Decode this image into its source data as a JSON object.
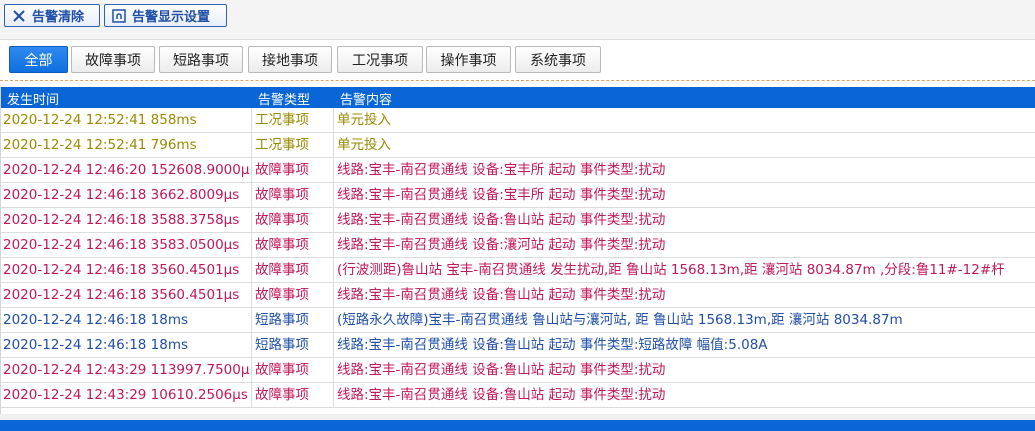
{
  "toolbar": {
    "clear_label": "告警清除",
    "settings_label": "告警显示设置"
  },
  "tabs": [
    {
      "label": "全部",
      "active": true
    },
    {
      "label": "故障事项"
    },
    {
      "label": "短路事项"
    },
    {
      "label": "接地事项"
    },
    {
      "label": "工况事项"
    },
    {
      "label": "操作事项"
    },
    {
      "label": "系统事项"
    }
  ],
  "table": {
    "headers": [
      "发生时间",
      "告警类型",
      "告警内容"
    ],
    "rows": [
      {
        "time": "2020-12-24 12:52:41 858ms",
        "type": "工况事项",
        "content": "单元投入",
        "color": "#9a8a00"
      },
      {
        "time": "2020-12-24 12:52:41 796ms",
        "type": "工况事项",
        "content": "单元投入",
        "color": "#9a8a00"
      },
      {
        "time": "2020-12-24 12:46:20 152608.9000μs",
        "type": "故障事项",
        "content": "线路:宝丰-南召贯通线 设备:宝丰所 起动  事件类型:扰动",
        "color": "#c0185a"
      },
      {
        "time": "2020-12-24 12:46:18 3662.8009μs",
        "type": "故障事项",
        "content": "线路:宝丰-南召贯通线 设备:宝丰所 起动  事件类型:扰动",
        "color": "#c0185a"
      },
      {
        "time": "2020-12-24 12:46:18 3588.3758μs",
        "type": "故障事项",
        "content": "线路:宝丰-南召贯通线 设备:鲁山站 起动  事件类型:扰动",
        "color": "#c0185a"
      },
      {
        "time": "2020-12-24 12:46:18 3583.0500μs",
        "type": "故障事项",
        "content": "线路:宝丰-南召贯通线 设备:瀼河站 起动  事件类型:扰动",
        "color": "#c0185a"
      },
      {
        "time": "2020-12-24 12:46:18 3560.4501μs",
        "type": "故障事项",
        "content": "(行波测距)鲁山站 宝丰-南召贯通线  发生扰动,距 鲁山站 1568.13m,距 瀼河站 8034.87m ,分段:鲁11#-12#杆",
        "color": "#c0185a"
      },
      {
        "time": "2020-12-24 12:46:18 3560.4501μs",
        "type": "故障事项",
        "content": "线路:宝丰-南召贯通线 设备:鲁山站 起动  事件类型:扰动",
        "color": "#c0185a"
      },
      {
        "time": "2020-12-24 12:46:18 18ms",
        "type": "短路事项",
        "content": "(短路永久故障)宝丰-南召贯通线 鲁山站与瀼河站, 距 鲁山站 1568.13m,距 瀼河站 8034.87m",
        "color": "#1f4fa8"
      },
      {
        "time": "2020-12-24 12:46:18 18ms",
        "type": "短路事项",
        "content": "线路:宝丰-南召贯通线 设备:鲁山站 起动  事件类型:短路故障 幅值:5.08A",
        "color": "#1f4fa8"
      },
      {
        "time": "2020-12-24 12:43:29 113997.7500μs",
        "type": "故障事项",
        "content": "线路:宝丰-南召贯通线 设备:鲁山站 起动  事件类型:扰动",
        "color": "#c0185a"
      },
      {
        "time": "2020-12-24 12:43:29 10610.2506μs",
        "type": "故障事项",
        "content": "线路:宝丰-南召贯通线 设备:鲁山站 起动  事件类型:扰动",
        "color": "#c0185a"
      }
    ]
  }
}
